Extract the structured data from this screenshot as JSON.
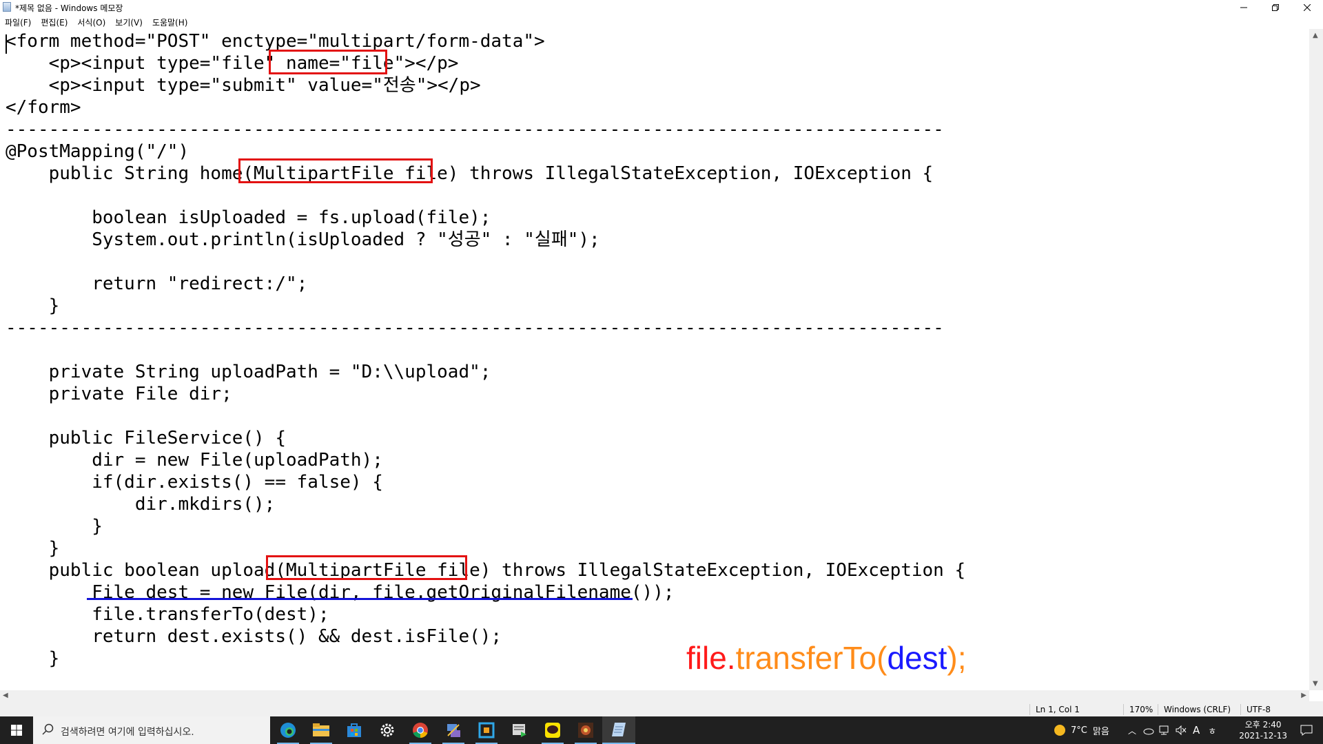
{
  "window": {
    "title": "*제목 없음 - Windows 메모장",
    "minimize": "—",
    "restore": "❐",
    "close": "✕"
  },
  "menu": {
    "items": [
      "파일(F)",
      "편집(E)",
      "서식(O)",
      "보기(V)",
      "도움말(H)"
    ]
  },
  "editor": {
    "lines": [
      "<form method=\"POST\" enctype=\"multipart/form-data\">",
      "    <p><input type=\"file\" name=\"file\"></p>",
      "    <p><input type=\"submit\" value=\"전송\"></p>",
      "</form>",
      "---------------------------------------------------------------------------------------",
      "@PostMapping(\"/\")",
      "    public String home(MultipartFile file) throws IllegalStateException, IOException {",
      "",
      "        boolean isUploaded = fs.upload(file);",
      "        System.out.println(isUploaded ? \"성공\" : \"실패\");",
      "",
      "        return \"redirect:/\";",
      "    }",
      "---------------------------------------------------------------------------------------",
      "",
      "    private String uploadPath = \"D:\\\\upload\";",
      "    private File dir;",
      "",
      "    public FileService() {",
      "        dir = new File(uploadPath);",
      "        if(dir.exists() == false) {",
      "            dir.mkdirs();",
      "        }",
      "    }",
      "    public boolean upload(MultipartFile file) throws IllegalStateException, IOException {",
      "        File dest = new File(dir, file.getOriginalFilename());",
      "        file.transferTo(dest);",
      "        return dest.exists() && dest.isFile();",
      "    }"
    ]
  },
  "annotation": {
    "part1": "file.",
    "part2": "transferTo(",
    "part3": "dest",
    "part4": ");",
    "color1": "#ff1a1a",
    "color2": "#ff8c1a",
    "color3": "#1a1aff",
    "color4": "#ff8c1a"
  },
  "highlights": {
    "box_color": "#e31111",
    "underline_color": "#1414d8"
  },
  "statusbar": {
    "position": "Ln 1, Col 1",
    "zoom": "170%",
    "line_ending": "Windows (CRLF)",
    "encoding": "UTF-8"
  },
  "taskbar": {
    "search_placeholder": "검색하려면 여기에 입력하십시오.",
    "apps": [
      "edge-icon",
      "file-explorer-icon",
      "store-icon",
      "settings-icon",
      "chrome-icon",
      "network-tool-icon",
      "remote-app-icon",
      "media-player-icon",
      "kakaotalk-icon",
      "game-icon",
      "notepad-icon"
    ],
    "weather_temp": "7°C",
    "weather_desc": "맑음",
    "ime": "A",
    "ime2": "ㅎ",
    "time": "오후 2:40",
    "date": "2021-12-13"
  }
}
